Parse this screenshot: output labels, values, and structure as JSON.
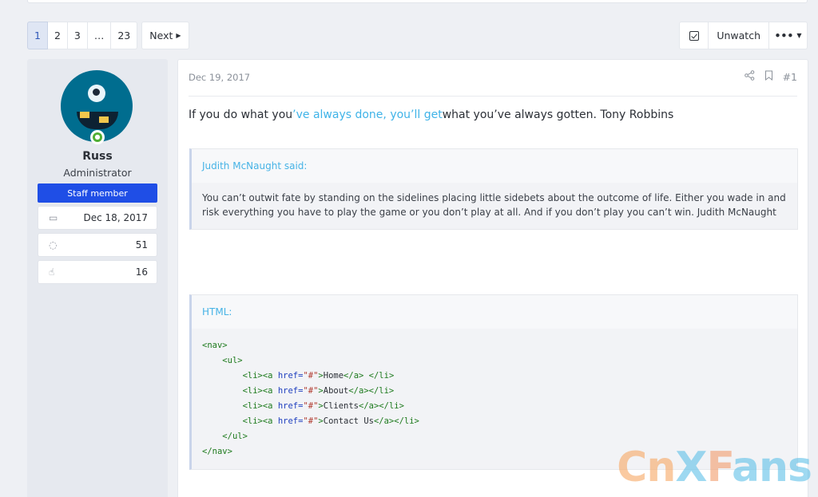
{
  "pagination": {
    "pages": [
      "1",
      "2",
      "3",
      "…",
      "23"
    ],
    "next_label": "Next"
  },
  "toolbar": {
    "unwatch_label": "Unwatch",
    "more_label": "•••"
  },
  "user": {
    "name": "Russ",
    "role": "Administrator",
    "badge": "Staff member",
    "joined": "Dec 18, 2017",
    "messages": "51",
    "reactions": "16"
  },
  "post": {
    "date": "Dec 19, 2017",
    "number": "#1",
    "text_before": "If you do what you",
    "text_highlight": "’ve always done, you’ll get",
    "text_after": "what you’ve always gotten. Tony Robbins"
  },
  "quote": {
    "author": "Judith McNaught said:",
    "body": "You can’t outwit fate by standing on the sidelines placing little sidebets about the outcome of life. Either you wade in and risk everything you have to play the game or you don’t play at all. And if you don’t play you can’t win. Judith McNaught"
  },
  "code_block": {
    "label": "HTML:",
    "lines": [
      {
        "indent": "",
        "open": "<nav>",
        "href": "",
        "text": "",
        "close": ""
      },
      {
        "indent": "    ",
        "open": "<ul>",
        "href": "",
        "text": "",
        "close": ""
      },
      {
        "indent": "        ",
        "open": "<li><a ",
        "href": "\"#\"",
        "text": "Home",
        "close": "</a> </li>"
      },
      {
        "indent": "        ",
        "open": "<li><a ",
        "href": "\"#\"",
        "text": "About",
        "close": "</a></li>"
      },
      {
        "indent": "        ",
        "open": "<li><a ",
        "href": "\"#\"",
        "text": "Clients",
        "close": "</a></li>"
      },
      {
        "indent": "        ",
        "open": "<li><a ",
        "href": "\"#\"",
        "text": "Contact Us",
        "close": "</a></li>"
      },
      {
        "indent": "    ",
        "open": "</ul>",
        "href": "",
        "text": "",
        "close": ""
      },
      {
        "indent": "",
        "open": "</nav>",
        "href": "",
        "text": "",
        "close": ""
      }
    ]
  },
  "watermark": {
    "part1": "Cn",
    "part2": "X",
    "part3": "F",
    "part4": "ans"
  },
  "colors": {
    "accent": "#1f4ee6",
    "link": "#3fb3e8",
    "online": "#4fae33"
  },
  "icons": {
    "check": "check-square-icon",
    "calendar": "calendar-icon",
    "messages": "comments-icon",
    "reactions": "thumbs-up-icon",
    "share": "share-icon",
    "bookmark": "bookmark-icon"
  }
}
